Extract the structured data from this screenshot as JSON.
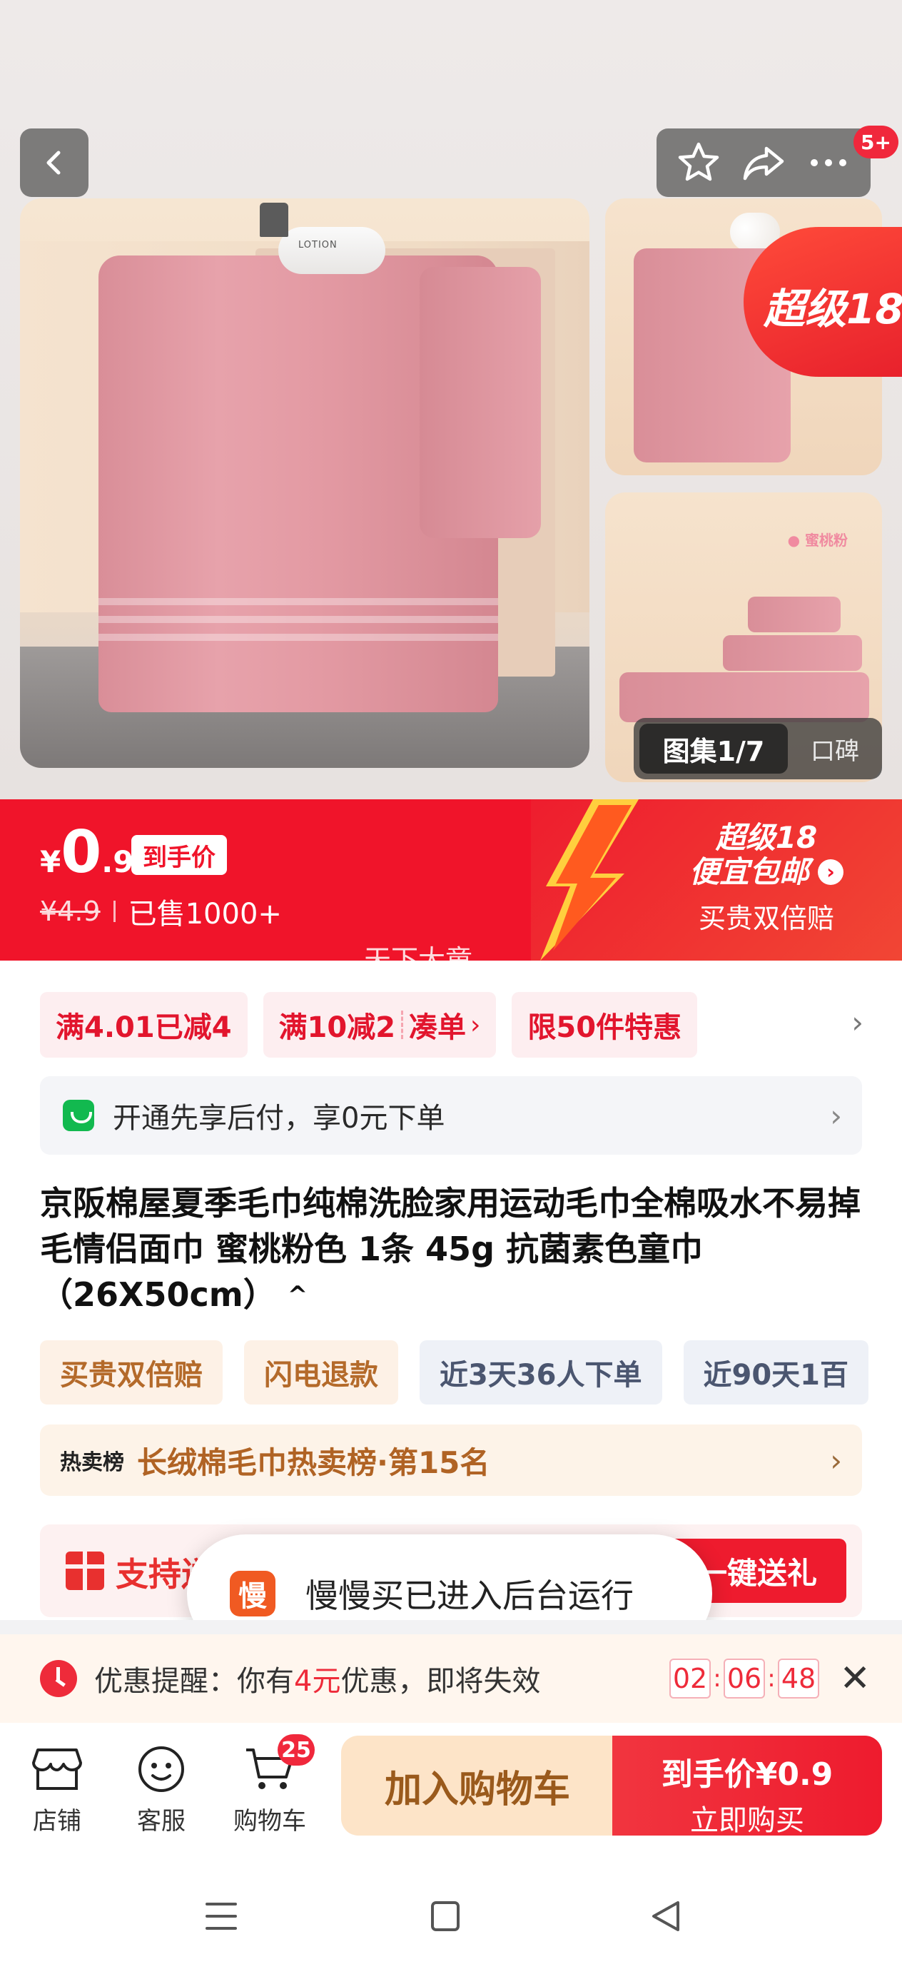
{
  "gallery": {
    "notification_count": "5+",
    "album_label": "图集1/7",
    "reviews_label": "口碑",
    "super_badge": "超级18",
    "main_image_lotion_text": "LOTION",
    "thumb_tag": "● 蜜桃粉"
  },
  "price_banner": {
    "currency": "¥",
    "price_int": "0",
    "price_dec": ".9",
    "price_tag": "到手价",
    "original_price": "¥4.9",
    "sold": "已售1000+",
    "promo_line1": "超级18",
    "promo_line2": "便宜包邮",
    "promo_line3": "买贵双倍赔",
    "watermark": "天下大童"
  },
  "coupons": [
    {
      "label": "满4.01已减4"
    },
    {
      "label": "满10减2",
      "action": "凑单"
    },
    {
      "label": "限50件特惠"
    }
  ],
  "pay_later": {
    "label": "开通先享后付，享0元下单"
  },
  "product": {
    "title": "京阪棉屋夏季毛巾纯棉洗脸家用运动毛巾全棉吸水不易掉毛情侣面巾 蜜桃粉色 1条 45g 抗菌素色童巾（26X50cm）"
  },
  "tags": [
    "买贵双倍赔",
    "闪电退款",
    "近3天36人下单",
    "近90天1百"
  ],
  "rank": {
    "hot_label": "热卖榜",
    "text": "长绒棉毛巾热卖榜·第15名"
  },
  "gift": {
    "text": "支持送",
    "button": "一键送礼"
  },
  "toast": {
    "app_icon_char": "慢",
    "message": "慢慢买已进入后台运行"
  },
  "reminder": {
    "prefix": "优惠提醒：你有",
    "amount": "4元",
    "suffix": "优惠，即将失效",
    "hours": "02",
    "minutes": "06",
    "seconds": "48"
  },
  "bottom_bar": {
    "shop": "店铺",
    "service": "客服",
    "cart": "购物车",
    "cart_count": "25",
    "add_to_cart": "加入购物车",
    "buy_price": "到手价¥0.9",
    "buy_now": "立即购买"
  },
  "colors": {
    "brand_red": "#f0142a",
    "accent_orange": "#b06324",
    "toast_icon": "#f05a22"
  }
}
